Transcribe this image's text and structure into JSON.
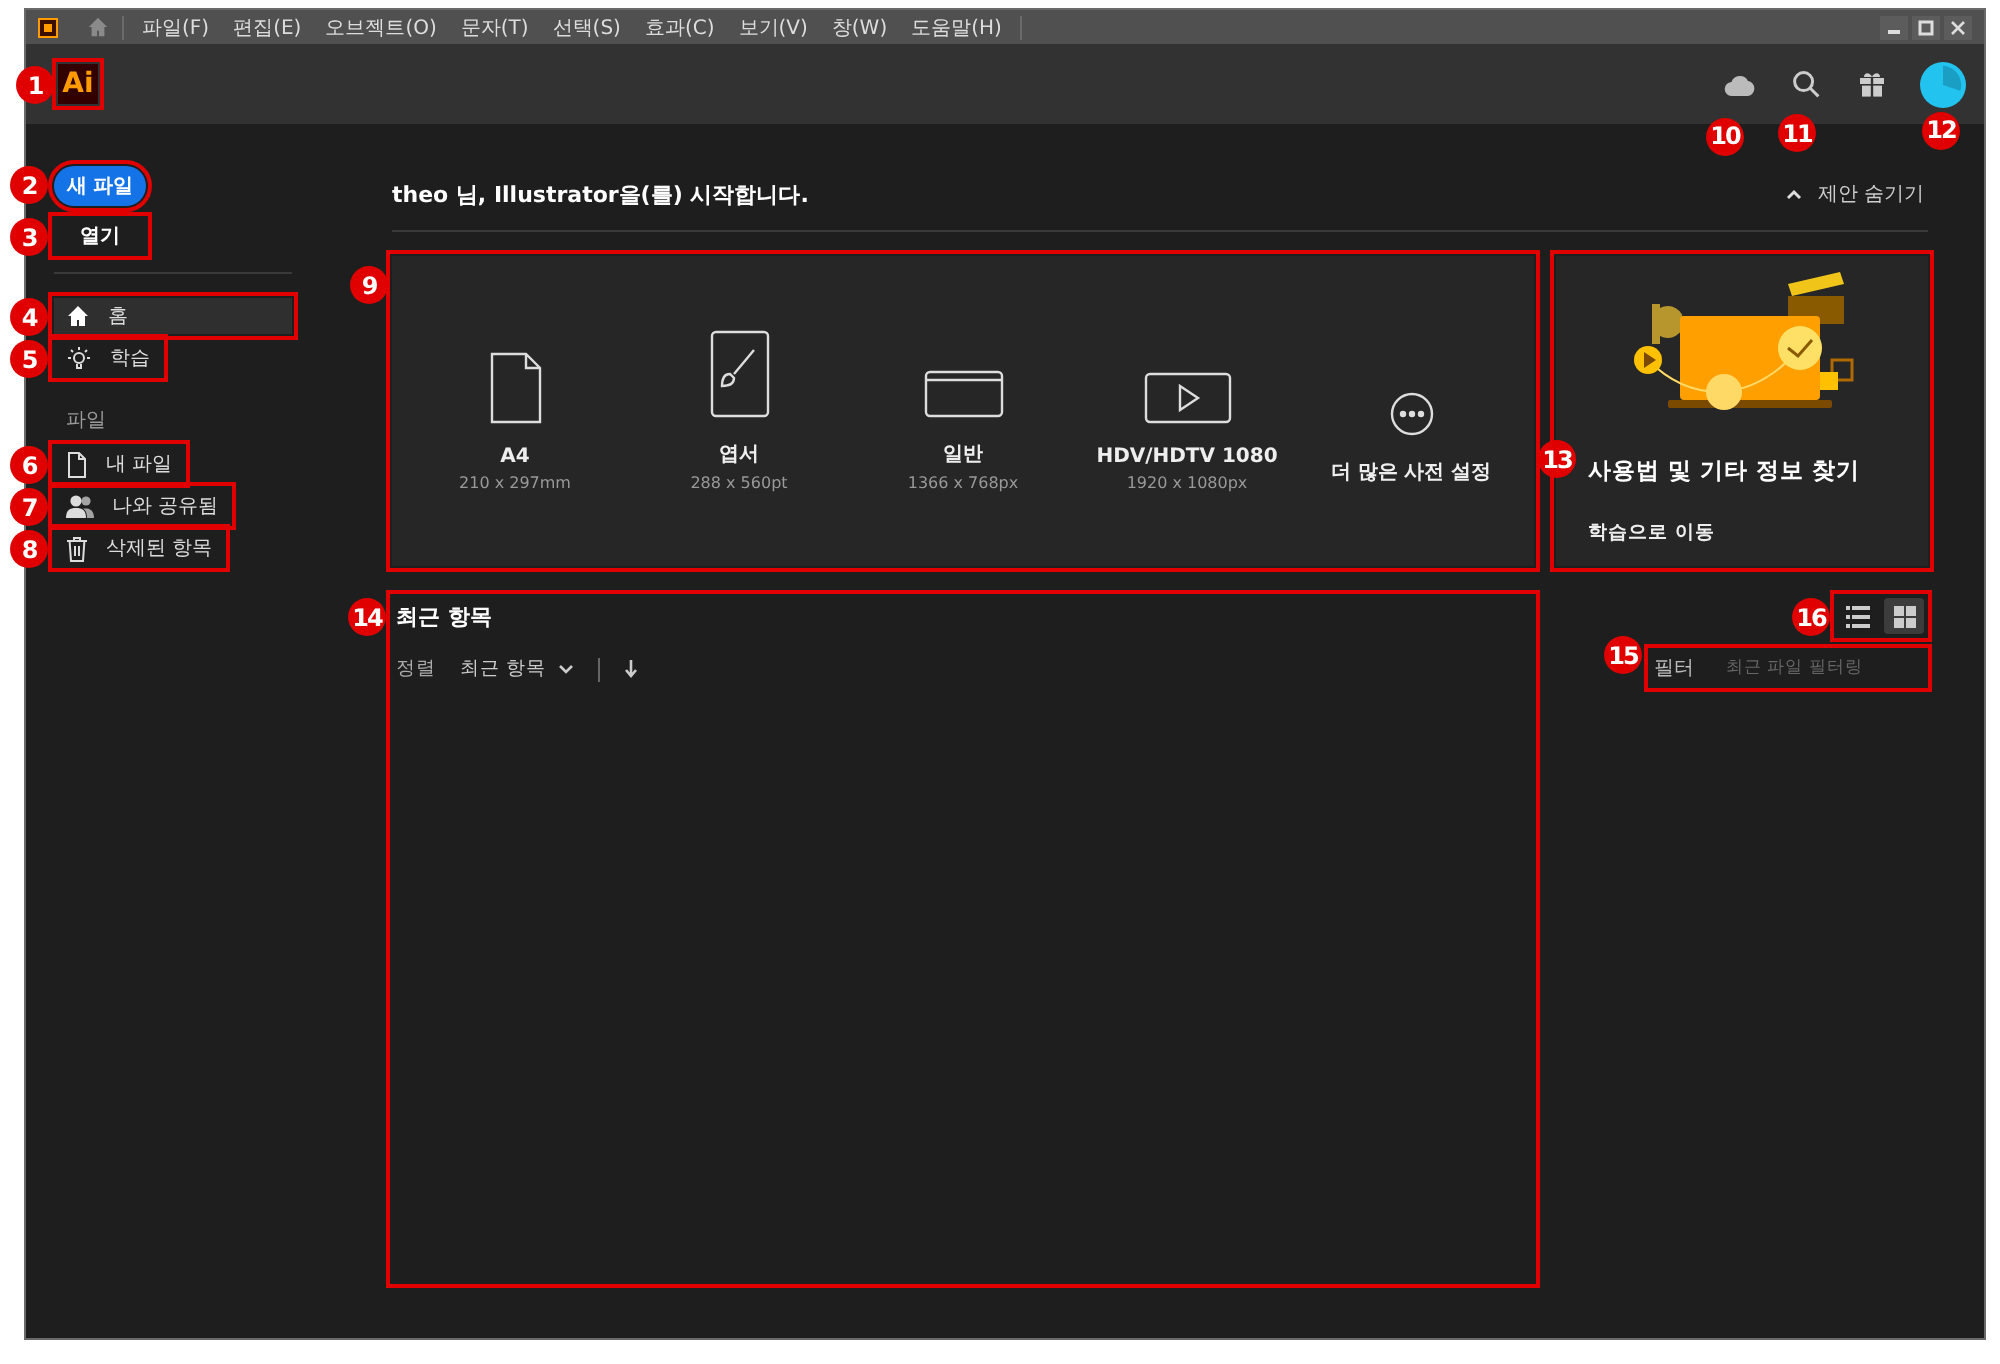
{
  "menu_bar": {
    "items": [
      "파일(F)",
      "편집(E)",
      "오브젝트(O)",
      "문자(T)",
      "선택(S)",
      "효과(C)",
      "보기(V)",
      "창(W)",
      "도움말(H)"
    ]
  },
  "header": {
    "logo": {
      "text": "Ai",
      "callout": "1"
    },
    "icons": [
      {
        "kind": "cloud",
        "callout": "10"
      },
      {
        "kind": "search",
        "callout": "11"
      },
      {
        "kind": "gift"
      },
      {
        "kind": "avatar",
        "callout": "12"
      }
    ]
  },
  "sidebar": {
    "new_file": {
      "label": "새 파일",
      "callout": "2"
    },
    "open": {
      "label": "열기",
      "callout": "3"
    },
    "nav": [
      {
        "kind": "home",
        "label": "홈",
        "selected": true,
        "callout": "4"
      },
      {
        "kind": "bulb",
        "label": "학습",
        "selected": false,
        "callout": "5"
      }
    ],
    "section": "파일",
    "files": [
      {
        "kind": "file",
        "label": "내 파일",
        "callout": "6"
      },
      {
        "kind": "people",
        "label": "나와 공유됨",
        "callout": "7"
      },
      {
        "kind": "trash",
        "label": "삭제된 항목",
        "callout": "8"
      }
    ]
  },
  "main": {
    "greeting": "theo 님, Illustrator을(를) 시작합니다.",
    "hide_button": "제안 숨기기",
    "presets": {
      "callout": "9",
      "items": [
        {
          "kind": "page",
          "name": "A4",
          "size": "210 x 297mm"
        },
        {
          "kind": "brush",
          "name": "엽서",
          "size": "288 x 560pt"
        },
        {
          "kind": "browser",
          "name": "일반",
          "size": "1366 x 768px"
        },
        {
          "kind": "video",
          "name": "HDV/HDTV 1080",
          "size": "1920 x 1080px"
        },
        {
          "kind": "more",
          "name": "더 많은 사전 설정"
        }
      ]
    },
    "learn_card": {
      "callout": "13",
      "title": "사용법 및 기타 정보 찾기",
      "link": "학습으로 이동"
    },
    "recent": {
      "callout": "14",
      "title": "최근 항목",
      "sort_label": "정렬",
      "sort_value": "최근 항목"
    },
    "view_toggle": {
      "callout": "16",
      "views": [
        {
          "kind": "list",
          "selected": false
        },
        {
          "kind": "grid",
          "selected": true
        }
      ]
    },
    "filter": {
      "callout": "15",
      "label": "필터",
      "placeholder": "최근 파일 필터링"
    }
  }
}
